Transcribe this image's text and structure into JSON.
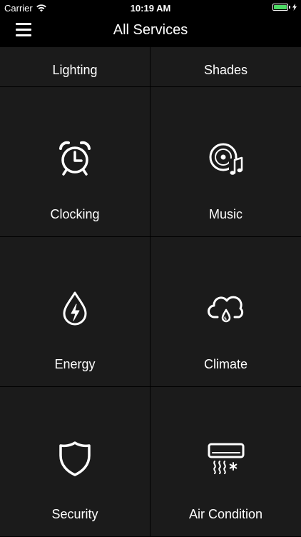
{
  "status_bar": {
    "carrier": "Carrier",
    "time": "10:19 AM",
    "battery_level": 1.0,
    "battery_color": "#4cd964",
    "icons": [
      "wifi-icon",
      "battery-icon",
      "charging-bolt-icon"
    ]
  },
  "nav": {
    "title": "All Services",
    "menu_icon": "hamburger-menu-icon"
  },
  "services": [
    {
      "label": "Lighting",
      "icon": "none"
    },
    {
      "label": "Shades",
      "icon": "none"
    },
    {
      "label": "Clocking",
      "icon": "alarm-clock-icon"
    },
    {
      "label": "Music",
      "icon": "music-disc-icon"
    },
    {
      "label": "Energy",
      "icon": "energy-drop-icon"
    },
    {
      "label": "Climate",
      "icon": "cloud-rain-icon"
    },
    {
      "label": "Security",
      "icon": "shield-icon"
    },
    {
      "label": "Air Condition",
      "icon": "air-conditioner-icon"
    }
  ],
  "colors": {
    "background": "#000000",
    "tile": "#1b1b1b",
    "text": "#ffffff"
  }
}
